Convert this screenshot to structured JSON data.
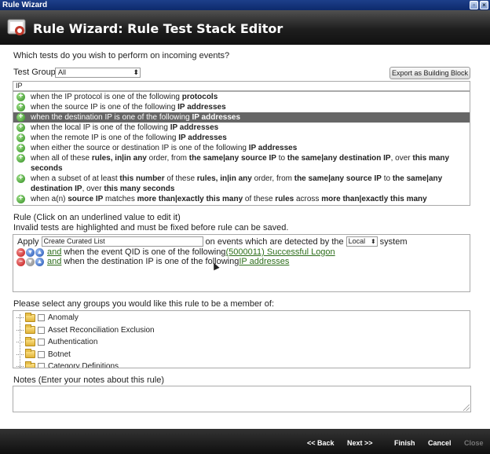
{
  "window": {
    "title": "Rule Wizard",
    "buttons": [
      "restore-icon",
      "close-icon"
    ]
  },
  "header": {
    "title": "Rule Wizard: Rule Test Stack Editor",
    "icon": "rule-wizard-icon"
  },
  "tests_section": {
    "question": "Which tests do you wish to perform on incoming events?",
    "test_group_label": "Test Group",
    "test_group_value": "All",
    "export_button": "Export as Building Block",
    "search_value": "IP",
    "selected_index": 2,
    "tests": [
      [
        {
          "t": "when the IP protocol is one of the following "
        },
        {
          "t": "protocols",
          "b": true
        }
      ],
      [
        {
          "t": "when the source IP is one of the following "
        },
        {
          "t": "IP addresses",
          "b": true
        }
      ],
      [
        {
          "t": "when the destination IP is one of the following "
        },
        {
          "t": "IP addresses",
          "b": true
        }
      ],
      [
        {
          "t": "when the local IP is one of the following "
        },
        {
          "t": "IP addresses",
          "b": true
        }
      ],
      [
        {
          "t": "when the remote IP is one of the following "
        },
        {
          "t": "IP addresses",
          "b": true
        }
      ],
      [
        {
          "t": "when either the source or destination IP is one of the following "
        },
        {
          "t": "IP addresses",
          "b": true
        }
      ],
      [
        {
          "t": "when all of these "
        },
        {
          "t": "rules, in|in any",
          "b": true
        },
        {
          "t": " order, from "
        },
        {
          "t": "the same|any source IP",
          "b": true
        },
        {
          "t": " to "
        },
        {
          "t": "the same|any destination IP",
          "b": true
        },
        {
          "t": ", over "
        },
        {
          "t": "this many seconds",
          "b": true
        }
      ],
      [
        {
          "t": "when a subset of at least "
        },
        {
          "t": "this number",
          "b": true
        },
        {
          "t": " of these "
        },
        {
          "t": "rules, in|in any",
          "b": true
        },
        {
          "t": " order, from "
        },
        {
          "t": "the same|any source IP",
          "b": true
        },
        {
          "t": " to "
        },
        {
          "t": "the same|any destination IP",
          "b": true
        },
        {
          "t": ", over "
        },
        {
          "t": "this many seconds",
          "b": true
        }
      ],
      [
        {
          "t": "when a(n) "
        },
        {
          "t": "source IP",
          "b": true
        },
        {
          "t": " matches "
        },
        {
          "t": "more than|exactly this many",
          "b": true
        },
        {
          "t": " of these "
        },
        {
          "t": "rules",
          "b": true
        },
        {
          "t": " across "
        },
        {
          "t": "more than|exactly this many destination IP",
          "b": true
        },
        {
          "t": ","
        }
      ]
    ]
  },
  "rule_section": {
    "title": "Rule (Click on an underlined value to edit it)",
    "warning": "Invalid tests are highlighted and must be fixed before rule can be saved.",
    "apply_label": "Apply",
    "rule_name": "Create Curated List",
    "on_events_text": "on events which are detected by the",
    "system_value": "Local",
    "system_text": "system",
    "conditions": [
      {
        "and": "and",
        "text": "when the event QID is one of the following ",
        "link": "(5000011) Successful Logon"
      },
      {
        "and": "and",
        "text": "when the destination IP is one of the following ",
        "link": "IP addresses"
      }
    ]
  },
  "groups_section": {
    "title": "Please select any groups you would like this rule to be a member of:",
    "groups": [
      "Anomaly",
      "Asset Reconciliation Exclusion",
      "Authentication",
      "Botnet",
      "Category Definitions"
    ]
  },
  "notes_section": {
    "title": "Notes (Enter your notes about this rule)",
    "value": ""
  },
  "footer": {
    "back": "<< Back",
    "next": "Next >>",
    "finish": "Finish",
    "cancel": "Cancel",
    "close": "Close"
  },
  "colors": {
    "selected_row": "#666666",
    "link_green": "#2d6e1b",
    "titlebar_blue": "#1d3f8a"
  }
}
